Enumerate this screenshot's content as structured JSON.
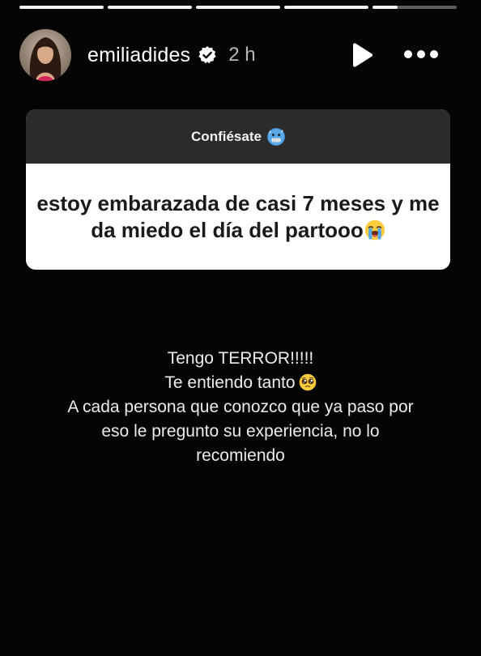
{
  "story": {
    "progress": [
      1,
      1,
      1,
      1,
      0.3
    ],
    "header": {
      "username": "emiliadides",
      "verified": true,
      "time_ago": "2 h",
      "play_icon": "play-icon",
      "more_icon": "more-icon"
    },
    "question_sticker": {
      "title": "Confiésate",
      "title_emoji": "cold-face-emoji",
      "question": "estoy embarazada de casi 7 meses y me da miedo el día del partooo",
      "question_emoji": "loudly-crying-face-emoji"
    },
    "answer": {
      "line1": "Tengo TERROR!!!!!",
      "line2": "Te entiendo tanto",
      "line2_emoji": "pleading-face-emoji",
      "line3": "A cada persona que conozco que ya paso por",
      "line4": "eso le pregunto su experiencia, no lo",
      "line5": "recomiendo"
    }
  }
}
